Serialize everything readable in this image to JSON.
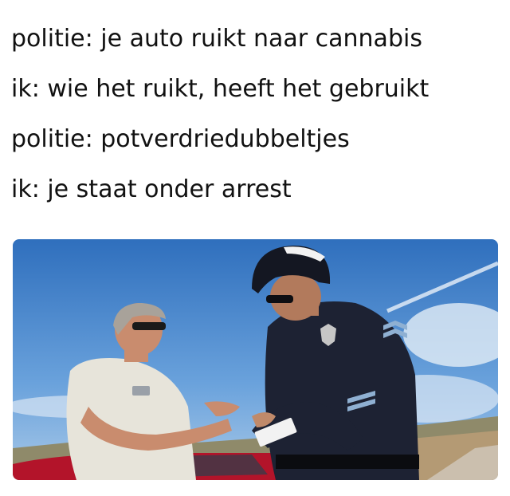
{
  "caption": {
    "lines": [
      "politie: je auto ruikt naar cannabis",
      "ik: wie het ruikt, heeft het gebruikt",
      "politie: potverdriedubbeltjes",
      "ik: je staat onder arrest"
    ]
  },
  "photo": {
    "subject": "police officer writing a ticket next to a man at a red car",
    "colors": {
      "sky": "#3f7fc9",
      "uniform": "#1d2233",
      "shirt": "#e7e4da",
      "car": "#b3142a",
      "ground": "#b49a74"
    }
  }
}
